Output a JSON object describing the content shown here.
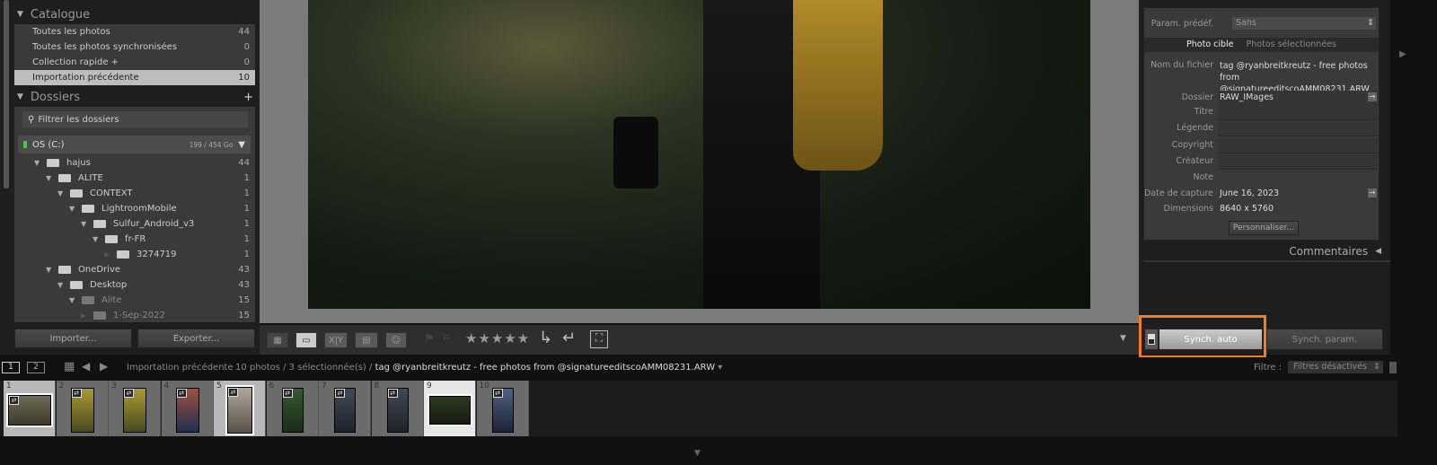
{
  "catalogue": {
    "title": "Catalogue",
    "items": [
      {
        "label": "Toutes les photos",
        "count": "44"
      },
      {
        "label": "Toutes les photos synchronisées",
        "count": "0"
      },
      {
        "label": "Collection rapide +",
        "count": "0"
      },
      {
        "label": "Importation précédente",
        "count": "10"
      }
    ]
  },
  "folders": {
    "title": "Dossiers",
    "add": "+",
    "filter_placeholder": "Filtrer les dossiers",
    "volume": {
      "name": "OS (C:)",
      "usage": "199 / 454 Go"
    },
    "tree": [
      {
        "label": "hajus",
        "count": "44",
        "depth": 0,
        "state": "open"
      },
      {
        "label": "ALITE",
        "count": "1",
        "depth": 1,
        "state": "open"
      },
      {
        "label": "CONTEXT",
        "count": "1",
        "depth": 2,
        "state": "open"
      },
      {
        "label": "LightroomMobile",
        "count": "1",
        "depth": 3,
        "state": "open"
      },
      {
        "label": "Sulfur_Android_v3",
        "count": "1",
        "depth": 4,
        "state": "open"
      },
      {
        "label": "fr-FR",
        "count": "1",
        "depth": 5,
        "state": "open"
      },
      {
        "label": "3274719",
        "count": "1",
        "depth": 6,
        "state": "leaf"
      },
      {
        "label": "OneDrive",
        "count": "43",
        "depth": 1,
        "state": "open"
      },
      {
        "label": "Desktop",
        "count": "43",
        "depth": 2,
        "state": "open"
      },
      {
        "label": "Alite",
        "count": "15",
        "depth": 3,
        "state": "missing"
      },
      {
        "label": "1-Sep-2022",
        "count": "15",
        "depth": 4,
        "state": "missing-leaf"
      }
    ]
  },
  "left_buttons": {
    "import": "Importer...",
    "export": "Exporter..."
  },
  "toolbar": {
    "xy": "X|Y",
    "rating_stars": "★★★★★"
  },
  "metadata": {
    "preset_label": "Param. prédéf.",
    "preset_value": "Sans",
    "tabs": [
      "Photo cible",
      "Photos sélectionnées"
    ],
    "fields": [
      {
        "label": "Nom du fichier",
        "value": "tag @ryanbreitkreutz - free photos from @signatureeditscoAMM08231.ARW"
      },
      {
        "label": "Dossier",
        "value": "RAW_IMages"
      },
      {
        "label": "Titre",
        "value": ""
      },
      {
        "label": "Légende",
        "value": ""
      },
      {
        "label": "Copyright",
        "value": ""
      },
      {
        "label": "Créateur",
        "value": ""
      },
      {
        "label": "Note",
        "value": ""
      },
      {
        "label": "Date de capture",
        "value": "June 16, 2023"
      },
      {
        "label": "Dimensions",
        "value": "8640 x 5760"
      }
    ],
    "customize": "Personnaliser..."
  },
  "comments": {
    "title": "Commentaires"
  },
  "sync": {
    "auto": "Synch. auto",
    "params": "Synch. param.",
    "highlight_color": "#f47c20"
  },
  "filmbar": {
    "screen1": "1",
    "screen2": "2",
    "source": "Importation précédente",
    "count": "10 photos / 3 sélectionnée(s) /",
    "filename": "tag @ryanbreitkreutz - free photos from @signatureeditscoAMM08231.ARW",
    "filter_label": "Filtre :",
    "filter_value": "Filtres désactivés"
  },
  "filmstrip": [
    {
      "n": "1",
      "sel": true
    },
    {
      "n": "2",
      "sel": false
    },
    {
      "n": "3",
      "sel": false
    },
    {
      "n": "4",
      "sel": false
    },
    {
      "n": "5",
      "sel": true
    },
    {
      "n": "6",
      "sel": false
    },
    {
      "n": "7",
      "sel": false
    },
    {
      "n": "8",
      "sel": false
    },
    {
      "n": "9",
      "sel": true,
      "active": true
    },
    {
      "n": "10",
      "sel": false
    }
  ]
}
